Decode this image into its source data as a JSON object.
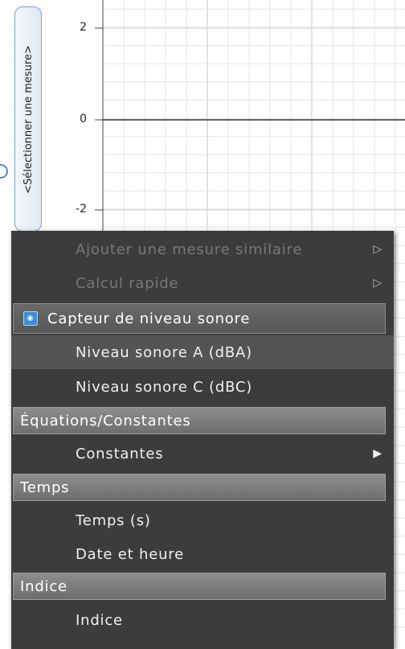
{
  "measure_selector": {
    "label": "<Sélectionner une mesure>"
  },
  "graph": {
    "y_ticks": [
      "2",
      "0",
      "-2"
    ]
  },
  "context_menu": {
    "items": [
      {
        "label": "Ajouter une mesure similaire",
        "enabled": false,
        "submenu_icon": "triangle-right-icon"
      },
      {
        "label": "Calcul rapide",
        "enabled": false,
        "submenu_icon": "triangle-right-icon"
      }
    ],
    "sensor_header": {
      "label": "Capteur de niveau sonore",
      "icon": "sensor-icon"
    },
    "sensor_items": [
      {
        "label": "Niveau sonore A (dBA)"
      },
      {
        "label": "Niveau sonore C (dBC)"
      }
    ],
    "sections": [
      {
        "header": "Équations/Constantes",
        "items": [
          "Constantes"
        ]
      },
      {
        "header": "Temps",
        "items": [
          "Temps (s)",
          "Date et heure"
        ]
      },
      {
        "header": "Indice",
        "items": [
          "Indice"
        ]
      }
    ]
  },
  "colors": {
    "menu_bg": "#3c3c3c",
    "grid_line": "#cfcfcf",
    "axis_line": "#333333",
    "selector_border": "#7aa0c8"
  }
}
